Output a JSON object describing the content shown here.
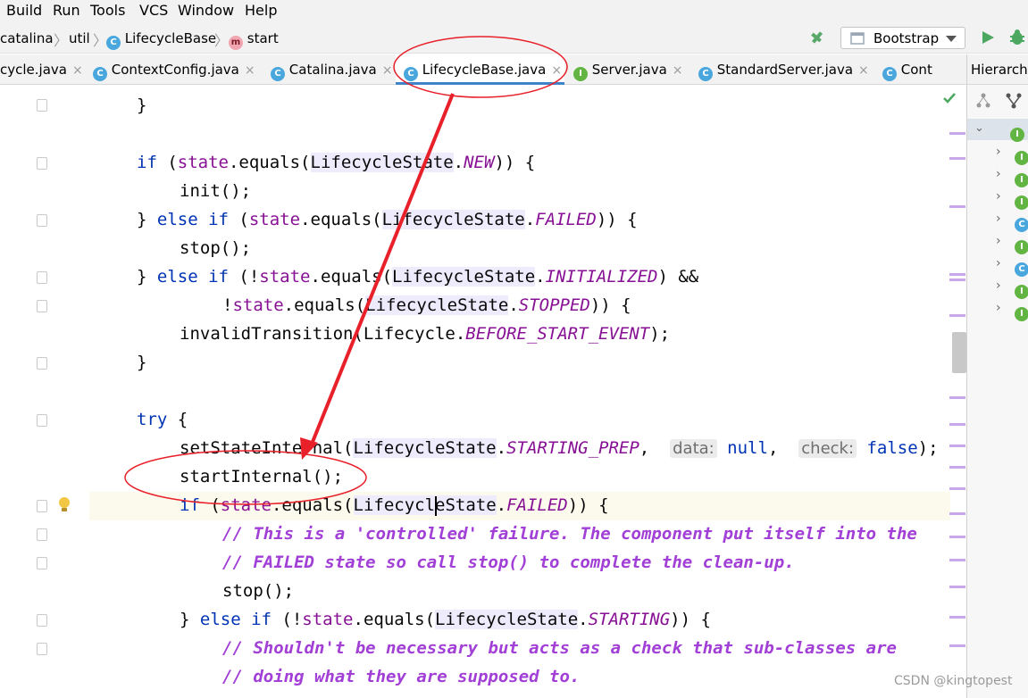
{
  "menu": [
    "Build",
    "Run",
    "Tools",
    "VCS",
    "Window",
    "Help"
  ],
  "breadcrumb": {
    "items": [
      "catalina",
      "util",
      "LifecycleBase",
      "start"
    ],
    "sep": "〉"
  },
  "run_config": {
    "label": "Bootstrap"
  },
  "tabs": [
    {
      "label": "cycle.java",
      "icon": "class"
    },
    {
      "label": "ContextConfig.java",
      "icon": "class"
    },
    {
      "label": "Catalina.java",
      "icon": "class"
    },
    {
      "label": "LifecycleBase.java",
      "icon": "class",
      "active": true
    },
    {
      "label": "Server.java",
      "icon": "interface"
    },
    {
      "label": "StandardServer.java",
      "icon": "class"
    },
    {
      "label": "Cont",
      "icon": "class"
    }
  ],
  "tab_close": "×",
  "hierarchy": {
    "title": "Hierarchy"
  },
  "icon_letters": {
    "class": "C",
    "interface": "I",
    "method": "m"
  },
  "code": {
    "l1": "}",
    "l3a": "if",
    "l3b": " (",
    "l3c": "state",
    "l3d": ".equals(",
    "l3e": "LifecycleState",
    "l3f": ".",
    "l3g": "NEW",
    "l3h": ")) {",
    "l4": "init();",
    "l5a": "} ",
    "l5b": "else if",
    "l5c": " (",
    "l5d": "state",
    "l5e": ".equals(",
    "l5f": "LifecycleState",
    "l5g": ".",
    "l5h": "FAILED",
    "l5i": ")) {",
    "l6": "stop();",
    "l7a": "} ",
    "l7b": "else if",
    "l7c": " (!",
    "l7d": "state",
    "l7e": ".equals(",
    "l7f": "LifecycleState",
    "l7g": ".",
    "l7h": "INITIALIZED",
    "l7i": ") &&",
    "l8a": "!",
    "l8b": "state",
    "l8c": ".equals(",
    "l8d": "LifecycleState",
    "l8e": ".",
    "l8f": "STOPPED",
    "l8g": ")) {",
    "l9a": "invalidTransition(Lifecycle.",
    "l9b": "BEFORE_START_EVENT",
    "l9c": ");",
    "l10": "}",
    "l12a": "try",
    "l12b": " {",
    "l13a": "setStateInternal(",
    "l13b": "LifecycleState",
    "l13c": ".",
    "l13d": "STARTING_PREP",
    "l13e": ",  ",
    "l13f": "data:",
    "l13g": " null",
    "l13h": ",  ",
    "l13i": "check:",
    "l13j": " false",
    "l13k": ");",
    "l14": "startInternal();",
    "l15a": "if",
    "l15b": " (",
    "l15c": "state",
    "l15d": ".equals(",
    "l15e": "LifecycleState",
    "l15f": ".",
    "l15g": "FAILED",
    "l15h": ")) {",
    "l16": "// This is a 'controlled' failure. The component put itself into the",
    "l17": "// FAILED state so call stop() to complete the clean-up.",
    "l18": "stop();",
    "l19a": "} ",
    "l19b": "else if",
    "l19c": " (!",
    "l19d": "state",
    "l19e": ".equals(",
    "l19f": "LifecycleState",
    "l19g": ".",
    "l19h": "STARTING",
    "l19i": ")) {",
    "l20": "// Shouldn't be necessary but acts as a check that sub-classes are",
    "l21": "// doing what they are supposed to."
  },
  "watermark": "CSDN @kingtopest",
  "colors": {
    "annotation": "#e8202a",
    "keyword": "#0033b3",
    "field": "#871094",
    "comment": "#a13fd6"
  }
}
